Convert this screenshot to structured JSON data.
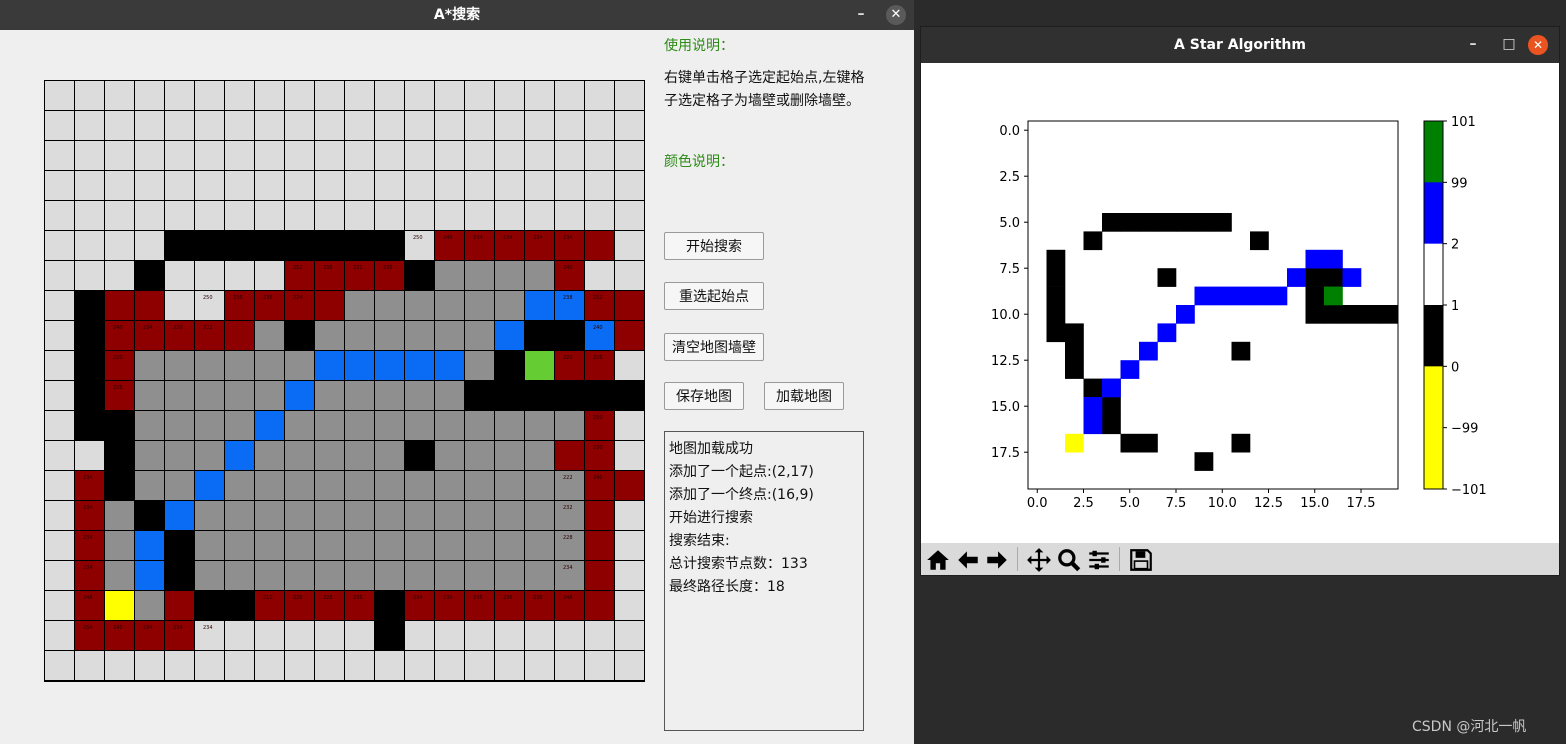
{
  "left_window": {
    "title": "A*搜索",
    "minimize_glyph": "–",
    "close_glyph": "✕",
    "grid": {
      "rows": 20,
      "cols": 20,
      "cell_legend": {
        "e": "empty",
        "w": "wall",
        "o": "open",
        "c": "closed",
        "p": "path",
        "s": "start",
        "g": "goal"
      },
      "map": [
        "eeeeeeeeeeeeeeeeeeee",
        "eeeeeeeeeeeeeeeeeeee",
        "eeeeeeeeeeeeeeeeeeee",
        "eeeeeeeeeeeeeeeeeeee",
        "eeeeeeeeeeeeeeeeeeee",
        "eeeewwwwwwwweooooooe",
        "eeeweeeeoooowccccoee",
        "ewooeeooooccccccppooe",
        "ewooooocwccccccpwwpoe",
        "ewoccccccpppppcwgooe",
        "ewocccccpcccccwwwwww",
        "ewwccccpccccccccccoe",
        "eewcccpcccccwccccooe",
        "eowccpccccccccccccooe",
        "eocwpcccccccccccccoe",
        "eocpwcccccccccccccoe",
        "eocpwcccccccccccccoe",
        "eoscowwoooowoooooooe",
        "eooooeeeeeeweeeeeeee",
        "eeeeeeeeeeeeeeeeeeee"
      ],
      "cost_labels": [
        {
          "r": 5,
          "c": 12,
          "t": "250"
        },
        {
          "r": 5,
          "c": 13,
          "t": "240"
        },
        {
          "r": 5,
          "c": 14,
          "t": "234"
        },
        {
          "r": 5,
          "c": 15,
          "t": "234"
        },
        {
          "r": 5,
          "c": 16,
          "t": "234"
        },
        {
          "r": 5,
          "c": 17,
          "t": "234"
        },
        {
          "r": 6,
          "c": 8,
          "t": "252"
        },
        {
          "r": 6,
          "c": 9,
          "t": "238"
        },
        {
          "r": 6,
          "c": 10,
          "t": "232"
        },
        {
          "r": 6,
          "c": 11,
          "t": "238"
        },
        {
          "r": 6,
          "c": 17,
          "t": "240"
        },
        {
          "r": 7,
          "c": 5,
          "t": "250"
        },
        {
          "r": 7,
          "c": 6,
          "t": "236"
        },
        {
          "r": 7,
          "c": 7,
          "t": "236"
        },
        {
          "r": 7,
          "c": 8,
          "t": "224"
        },
        {
          "r": 7,
          "c": 17,
          "t": "238"
        },
        {
          "r": 7,
          "c": 18,
          "t": "252"
        },
        {
          "r": 8,
          "c": 2,
          "t": "240"
        },
        {
          "r": 8,
          "c": 3,
          "t": "234"
        },
        {
          "r": 8,
          "c": 4,
          "t": "220"
        },
        {
          "r": 8,
          "c": 5,
          "t": "222"
        },
        {
          "r": 8,
          "c": 18,
          "t": "240"
        },
        {
          "r": 9,
          "c": 2,
          "t": "220"
        },
        {
          "r": 9,
          "c": 17,
          "t": "220"
        },
        {
          "r": 9,
          "c": 18,
          "t": "226"
        },
        {
          "r": 10,
          "c": 2,
          "t": "226"
        },
        {
          "r": 11,
          "c": 18,
          "t": "250"
        },
        {
          "r": 12,
          "c": 18,
          "t": "230"
        },
        {
          "r": 13,
          "c": 1,
          "t": "234"
        },
        {
          "r": 13,
          "c": 17,
          "t": "222"
        },
        {
          "r": 13,
          "c": 18,
          "t": "240"
        },
        {
          "r": 14,
          "c": 1,
          "t": "234"
        },
        {
          "r": 14,
          "c": 17,
          "t": "232"
        },
        {
          "r": 15,
          "c": 1,
          "t": "234"
        },
        {
          "r": 15,
          "c": 17,
          "t": "228"
        },
        {
          "r": 16,
          "c": 1,
          "t": "234"
        },
        {
          "r": 16,
          "c": 17,
          "t": "234"
        },
        {
          "r": 17,
          "c": 1,
          "t": "248"
        },
        {
          "r": 17,
          "c": 7,
          "t": "210"
        },
        {
          "r": 17,
          "c": 8,
          "t": "226"
        },
        {
          "r": 17,
          "c": 9,
          "t": "228"
        },
        {
          "r": 17,
          "c": 10,
          "t": "236"
        },
        {
          "r": 17,
          "c": 12,
          "t": "234"
        },
        {
          "r": 17,
          "c": 13,
          "t": "230"
        },
        {
          "r": 17,
          "c": 14,
          "t": "236"
        },
        {
          "r": 17,
          "c": 15,
          "t": "236"
        },
        {
          "r": 17,
          "c": 16,
          "t": "236"
        },
        {
          "r": 17,
          "c": 17,
          "t": "248"
        },
        {
          "r": 18,
          "c": 1,
          "t": "254"
        },
        {
          "r": 18,
          "c": 2,
          "t": "240"
        },
        {
          "r": 18,
          "c": 3,
          "t": "234"
        },
        {
          "r": 18,
          "c": 4,
          "t": "234"
        },
        {
          "r": 18,
          "c": 5,
          "t": "234"
        }
      ]
    },
    "instructions_heading": "使用说明：",
    "instructions_text": "右键单击格子选定起始点,左键格子选定格子为墙壁或删除墙壁。",
    "color_heading": "颜色说明：",
    "buttons": {
      "start_search": "开始搜索",
      "reselect_points": "重选起始点",
      "clear_walls": "清空地图墙壁",
      "save_map": "保存地图",
      "load_map": "加载地图"
    },
    "log_lines": [
      "地图加载成功",
      "添加了一个起点:(2,17)",
      "添加了一个终点:(16,9)",
      "开始进行搜索",
      "搜索结束:",
      "总计搜索节点数：133",
      "最终路径长度：18"
    ]
  },
  "right_window": {
    "title": "A Star Algorithm",
    "window_controls": {
      "minimize": "–",
      "maximize": "□",
      "close": "✕"
    },
    "toolbar_icons": [
      "home-icon",
      "back-arrow-icon",
      "forward-arrow-icon",
      "pan-icon",
      "zoom-icon",
      "configure-icon",
      "save-icon"
    ]
  },
  "chart_data": {
    "type": "heatmap",
    "title": "",
    "xlim": [
      -0.5,
      19.5
    ],
    "ylim": [
      19.5,
      -0.5
    ],
    "x_ticks": [
      "0.0",
      "2.5",
      "5.0",
      "7.5",
      "10.0",
      "12.5",
      "15.0",
      "17.5"
    ],
    "y_ticks": [
      "0.0",
      "2.5",
      "5.0",
      "7.5",
      "10.0",
      "12.5",
      "15.0",
      "17.5"
    ],
    "colorbar": {
      "boundaries": [
        -101,
        -99,
        0,
        1,
        2,
        99,
        101
      ],
      "colors": [
        "#ffff00",
        "#ffff00",
        "#000000",
        "#ffffff",
        "#0000ff",
        "#008000"
      ],
      "tick_labels": [
        "101",
        "99",
        "2",
        "1",
        "0",
        "−99",
        "−101"
      ]
    },
    "cells": {
      "wall": [
        [
          4,
          5
        ],
        [
          5,
          5
        ],
        [
          6,
          5
        ],
        [
          7,
          5
        ],
        [
          8,
          5
        ],
        [
          9,
          5
        ],
        [
          10,
          5
        ],
        [
          3,
          6
        ],
        [
          12,
          6
        ],
        [
          1,
          7
        ],
        [
          1,
          8
        ],
        [
          1,
          9
        ],
        [
          1,
          10
        ],
        [
          1,
          11
        ],
        [
          2,
          11
        ],
        [
          2,
          12
        ],
        [
          2,
          13
        ],
        [
          7,
          8
        ],
        [
          15,
          8
        ],
        [
          16,
          8
        ],
        [
          15,
          9
        ],
        [
          15,
          10
        ],
        [
          16,
          10
        ],
        [
          17,
          10
        ],
        [
          18,
          10
        ],
        [
          19,
          10
        ],
        [
          11,
          12
        ],
        [
          3,
          14
        ],
        [
          4,
          14
        ],
        [
          4,
          15
        ],
        [
          4,
          16
        ],
        [
          5,
          17
        ],
        [
          6,
          17
        ],
        [
          11,
          17
        ],
        [
          9,
          18
        ]
      ],
      "path": [
        [
          15,
          7
        ],
        [
          16,
          7
        ],
        [
          14,
          8
        ],
        [
          17,
          8
        ],
        [
          9,
          9
        ],
        [
          10,
          9
        ],
        [
          11,
          9
        ],
        [
          12,
          9
        ],
        [
          13,
          9
        ],
        [
          8,
          10
        ],
        [
          7,
          11
        ],
        [
          6,
          12
        ],
        [
          5,
          13
        ],
        [
          4,
          14
        ],
        [
          3,
          15
        ],
        [
          3,
          16
        ]
      ],
      "start": [
        [
          2,
          17
        ]
      ],
      "goal": [
        [
          16,
          9
        ]
      ]
    }
  },
  "watermark": "CSDN @河北一帆"
}
